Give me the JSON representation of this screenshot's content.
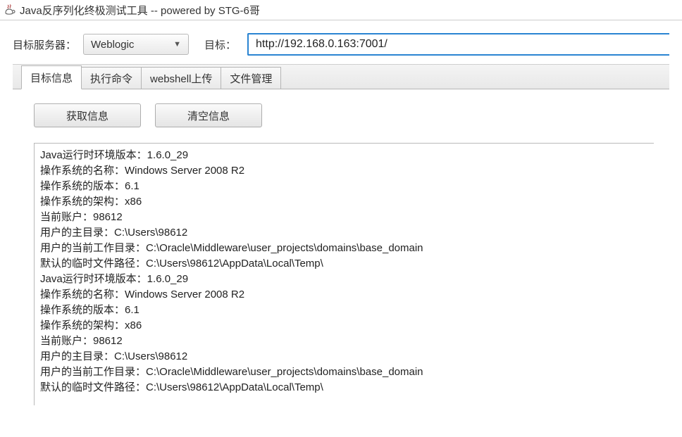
{
  "window": {
    "title": "Java反序列化终极测试工具  -- powered by STG-6哥"
  },
  "top": {
    "server_label": "目标服务器：",
    "server_selected": "Weblogic",
    "target_label": "目标：",
    "target_url": "http://192.168.0.163:7001/"
  },
  "tabs": [
    {
      "label": "目标信息",
      "active": true
    },
    {
      "label": "执行命令",
      "active": false
    },
    {
      "label": "webshell上传",
      "active": false
    },
    {
      "label": "文件管理",
      "active": false
    }
  ],
  "actions": {
    "fetch": "获取信息",
    "clear": "清空信息"
  },
  "output_text": "Java运行时环境版本：1.6.0_29\n操作系统的名称：Windows Server 2008 R2\n操作系统的版本：6.1\n操作系统的架构：x86\n当前账户：98612\n用户的主目录：C:\\Users\\98612\n用户的当前工作目录：C:\\Oracle\\Middleware\\user_projects\\domains\\base_domain\n默认的临时文件路径：C:\\Users\\98612\\AppData\\Local\\Temp\\\nJava运行时环境版本：1.6.0_29\n操作系统的名称：Windows Server 2008 R2\n操作系统的版本：6.1\n操作系统的架构：x86\n当前账户：98612\n用户的主目录：C:\\Users\\98612\n用户的当前工作目录：C:\\Oracle\\Middleware\\user_projects\\domains\\base_domain\n默认的临时文件路径：C:\\Users\\98612\\AppData\\Local\\Temp\\"
}
